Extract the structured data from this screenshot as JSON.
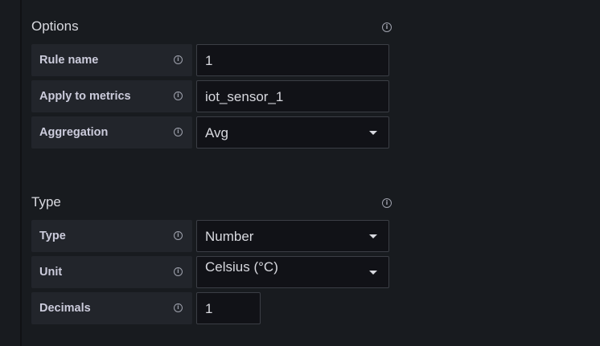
{
  "options": {
    "title": "Options",
    "rows": [
      {
        "label": "Rule name",
        "value": "1"
      },
      {
        "label": "Apply to metrics",
        "value": "iot_sensor_1"
      },
      {
        "label": "Aggregation",
        "value": "Avg"
      }
    ]
  },
  "type_section": {
    "title": "Type",
    "rows": [
      {
        "label": "Type",
        "value": "Number"
      },
      {
        "label": "Unit",
        "value": "Celsius (°C)"
      },
      {
        "label": "Decimals",
        "value": "1"
      }
    ]
  },
  "icons": {
    "info": "info-icon",
    "dropdown": "chevron-down-icon"
  },
  "colors": {
    "background": "#181b1f",
    "label_background": "#22252b",
    "input_background": "#111217",
    "input_border": "#3b3e45",
    "text": "#ccccdc"
  }
}
